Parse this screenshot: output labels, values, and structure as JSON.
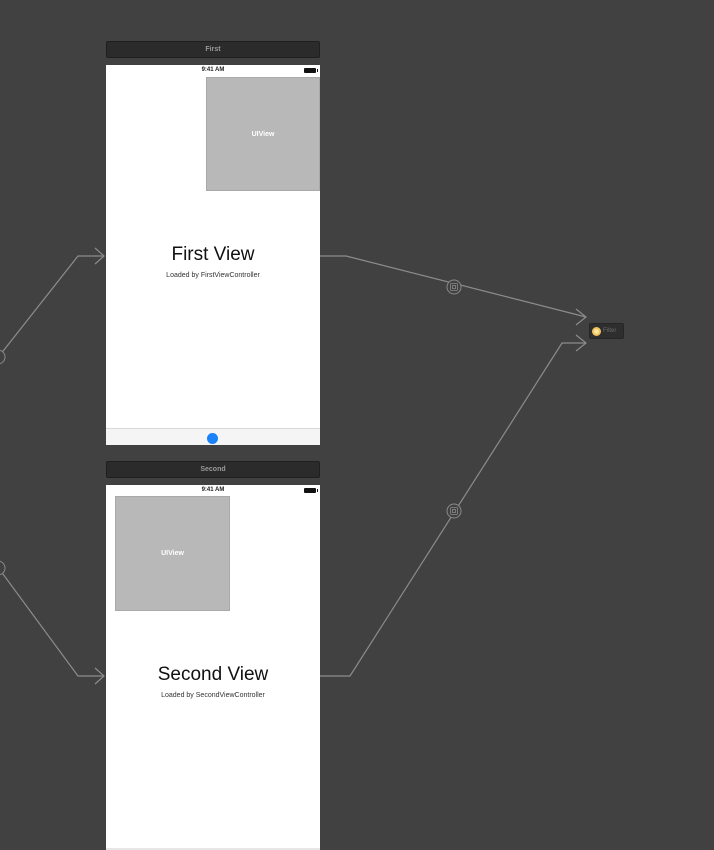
{
  "canvas": {
    "background": "#414141"
  },
  "first_scene": {
    "title": "First",
    "status_time": "9:41 AM",
    "uiview_label": "UIView",
    "heading": "First View",
    "subtitle": "Loaded by FirstViewController",
    "tab_accent": "#1a82fb"
  },
  "second_scene": {
    "title": "Second",
    "status_time": "9:41 AM",
    "uiview_label": "UIView",
    "heading": "Second View",
    "subtitle": "Loaded by SecondViewController"
  },
  "filter": {
    "label": "Filter",
    "icon": "filter-icon"
  },
  "segues": [
    "relationship-segue-icon",
    "relationship-segue-icon"
  ]
}
